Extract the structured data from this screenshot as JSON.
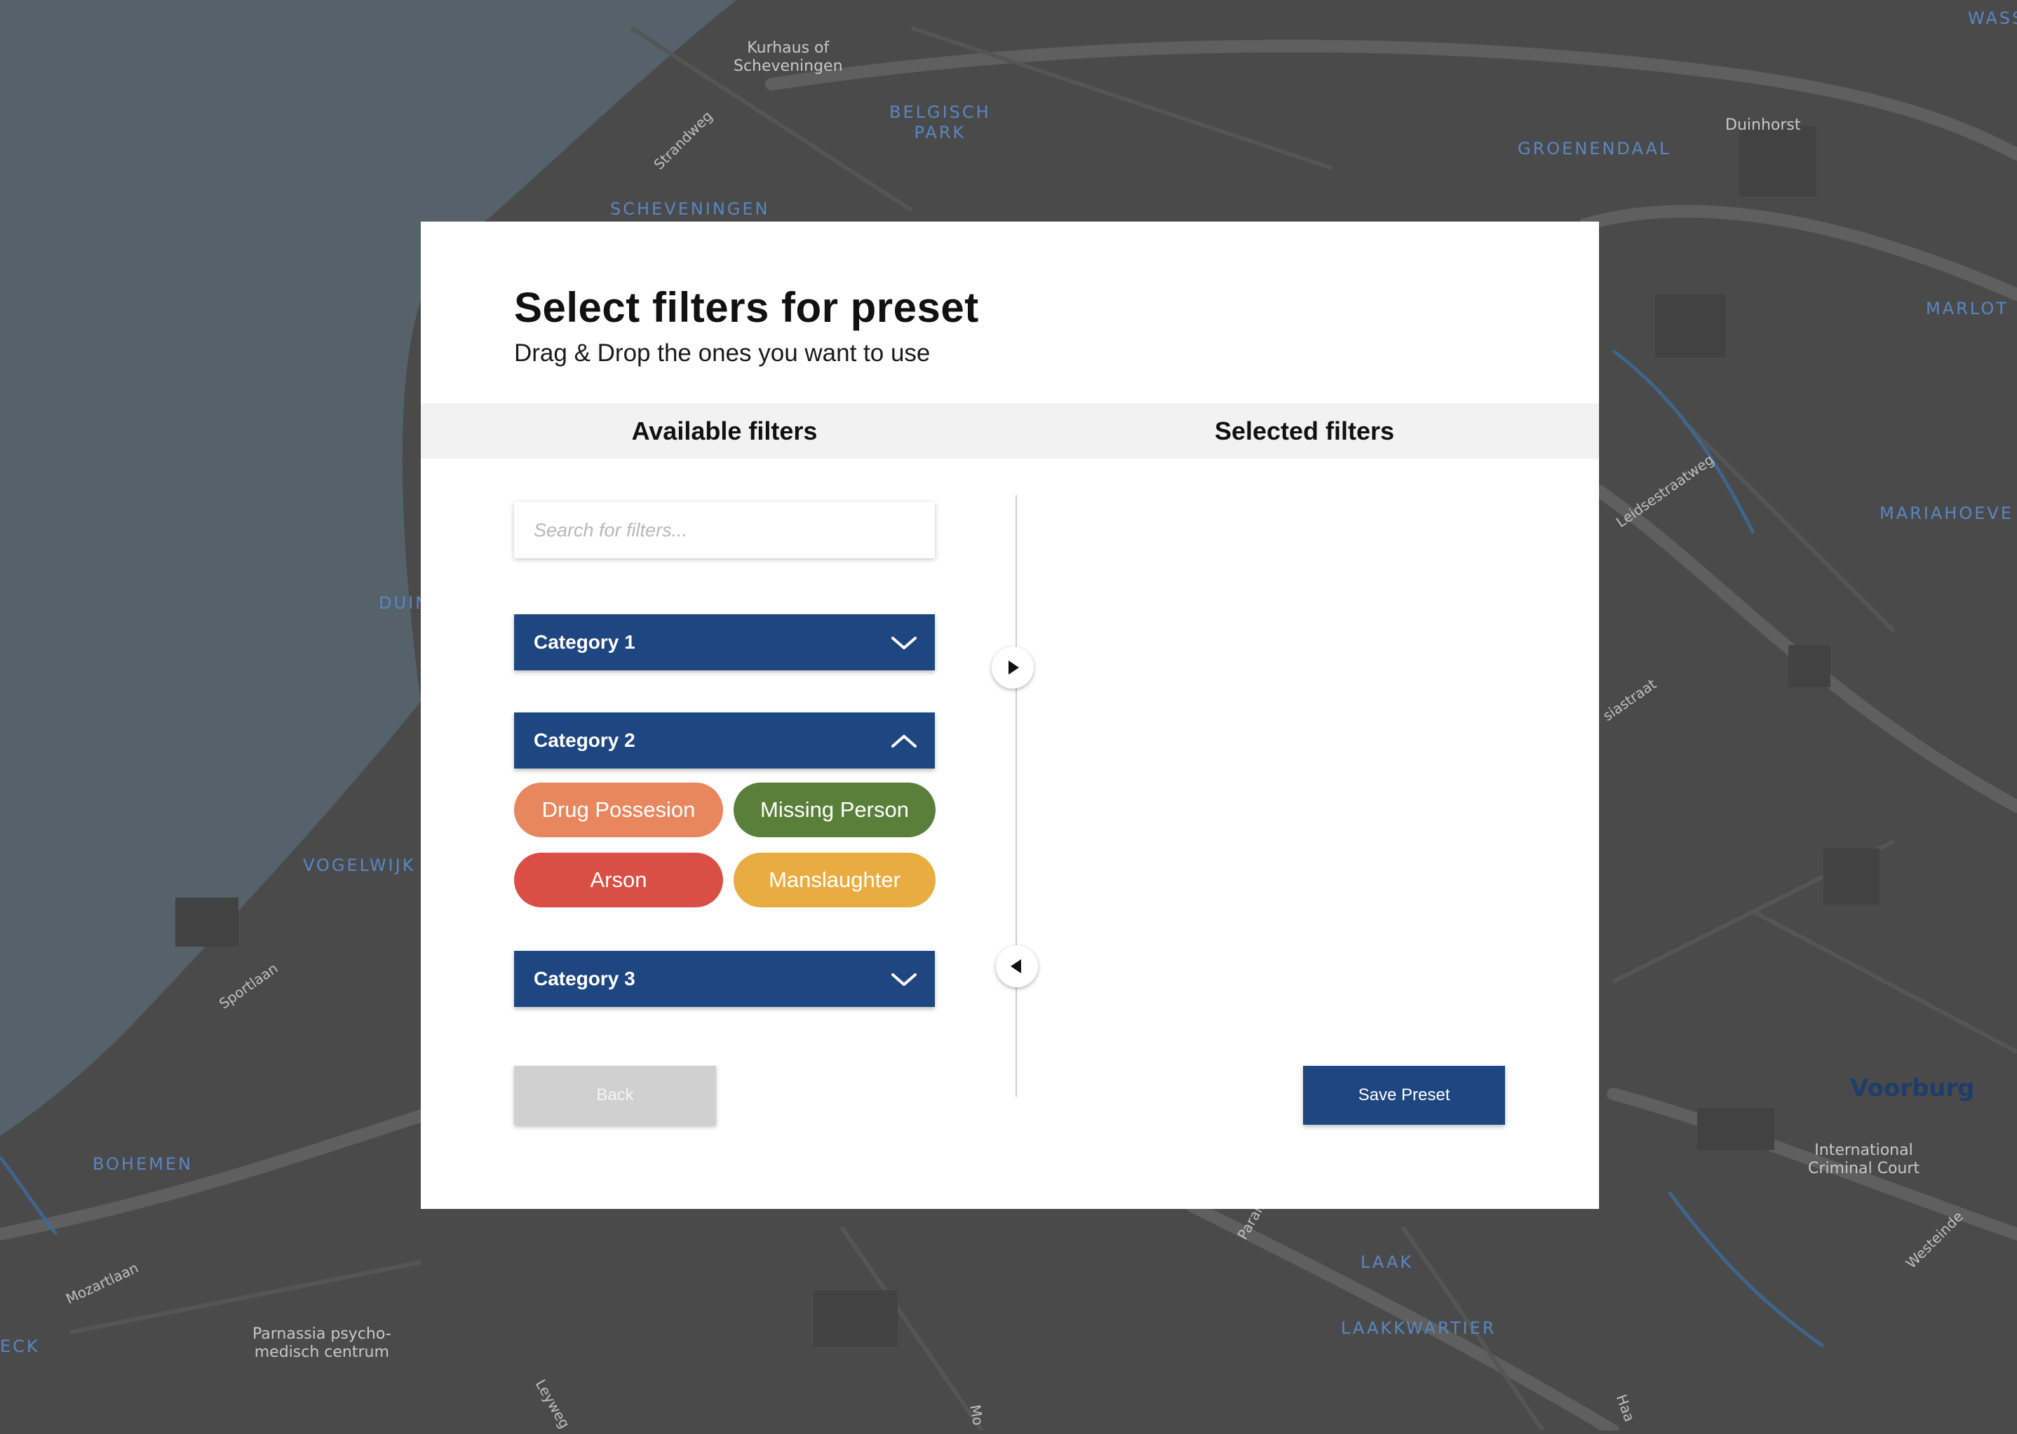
{
  "map": {
    "labels": {
      "kurhaus": "Kurhaus of\nScheveningen",
      "belgisch_park": "BELGISCH\nPARK",
      "strandweg": "Strandweg",
      "scheveningen": "SCHEVENINGEN",
      "groenendaal": "GROENENDAAL",
      "duinhorst": "Duinhorst",
      "wass": "WASS",
      "marlot": "MARLOT",
      "mariahoeve": "MARIAHOEVE",
      "leidsestraatweg": "Leidsestraatweg",
      "duin": "DUIN",
      "siastraat": "siastraat",
      "vogelwijk": "VOGELWIJK",
      "sportlaan": "Sportlaan",
      "bohemen": "BOHEMEN",
      "mozartlaan": "Mozartlaan",
      "eck": "ECK",
      "parnassia": "Parnassia psycho-\nmedisch centrum",
      "leyweg": "Leyweg",
      "voorburg": "Voorburg",
      "icc": "International\nCriminal Court",
      "westeinde": "Westeinde",
      "laak": "LAAK",
      "laakkwartier": "LAAKKWARTIER",
      "parall": "Parall",
      "mo": "Mo",
      "haa": "Haa"
    },
    "colors": {
      "water": "#56626a",
      "land": "#4a4a4a",
      "road": "#5c5c5c"
    }
  },
  "modal": {
    "title": "Select filters for preset",
    "subtitle": "Drag & Drop the ones you want to use",
    "available_title": "Available filters",
    "selected_title": "Selected filters",
    "search": {
      "placeholder": "Search for filters...",
      "value": ""
    },
    "categories": [
      {
        "label": "Category 1",
        "expanded": false,
        "chevron": "chevron-down-icon"
      },
      {
        "label": "Category 2",
        "expanded": true,
        "chevron": "chevron-up-icon"
      },
      {
        "label": "Category 3",
        "expanded": false,
        "chevron": "chevron-down-icon"
      }
    ],
    "tags": [
      {
        "label": "Drug Possesion",
        "color": "#e8875e"
      },
      {
        "label": "Missing Person",
        "color": "#5a7f3a"
      },
      {
        "label": "Arson",
        "color": "#d94e45"
      },
      {
        "label": "Manslaughter",
        "color": "#e8ac40"
      }
    ],
    "arrows": {
      "add": "play-right-icon",
      "remove": "play-left-icon"
    },
    "back_label": "Back",
    "save_label": "Save Preset",
    "accent_color": "#1e4680",
    "disabled_color": "#d0d0d0"
  }
}
